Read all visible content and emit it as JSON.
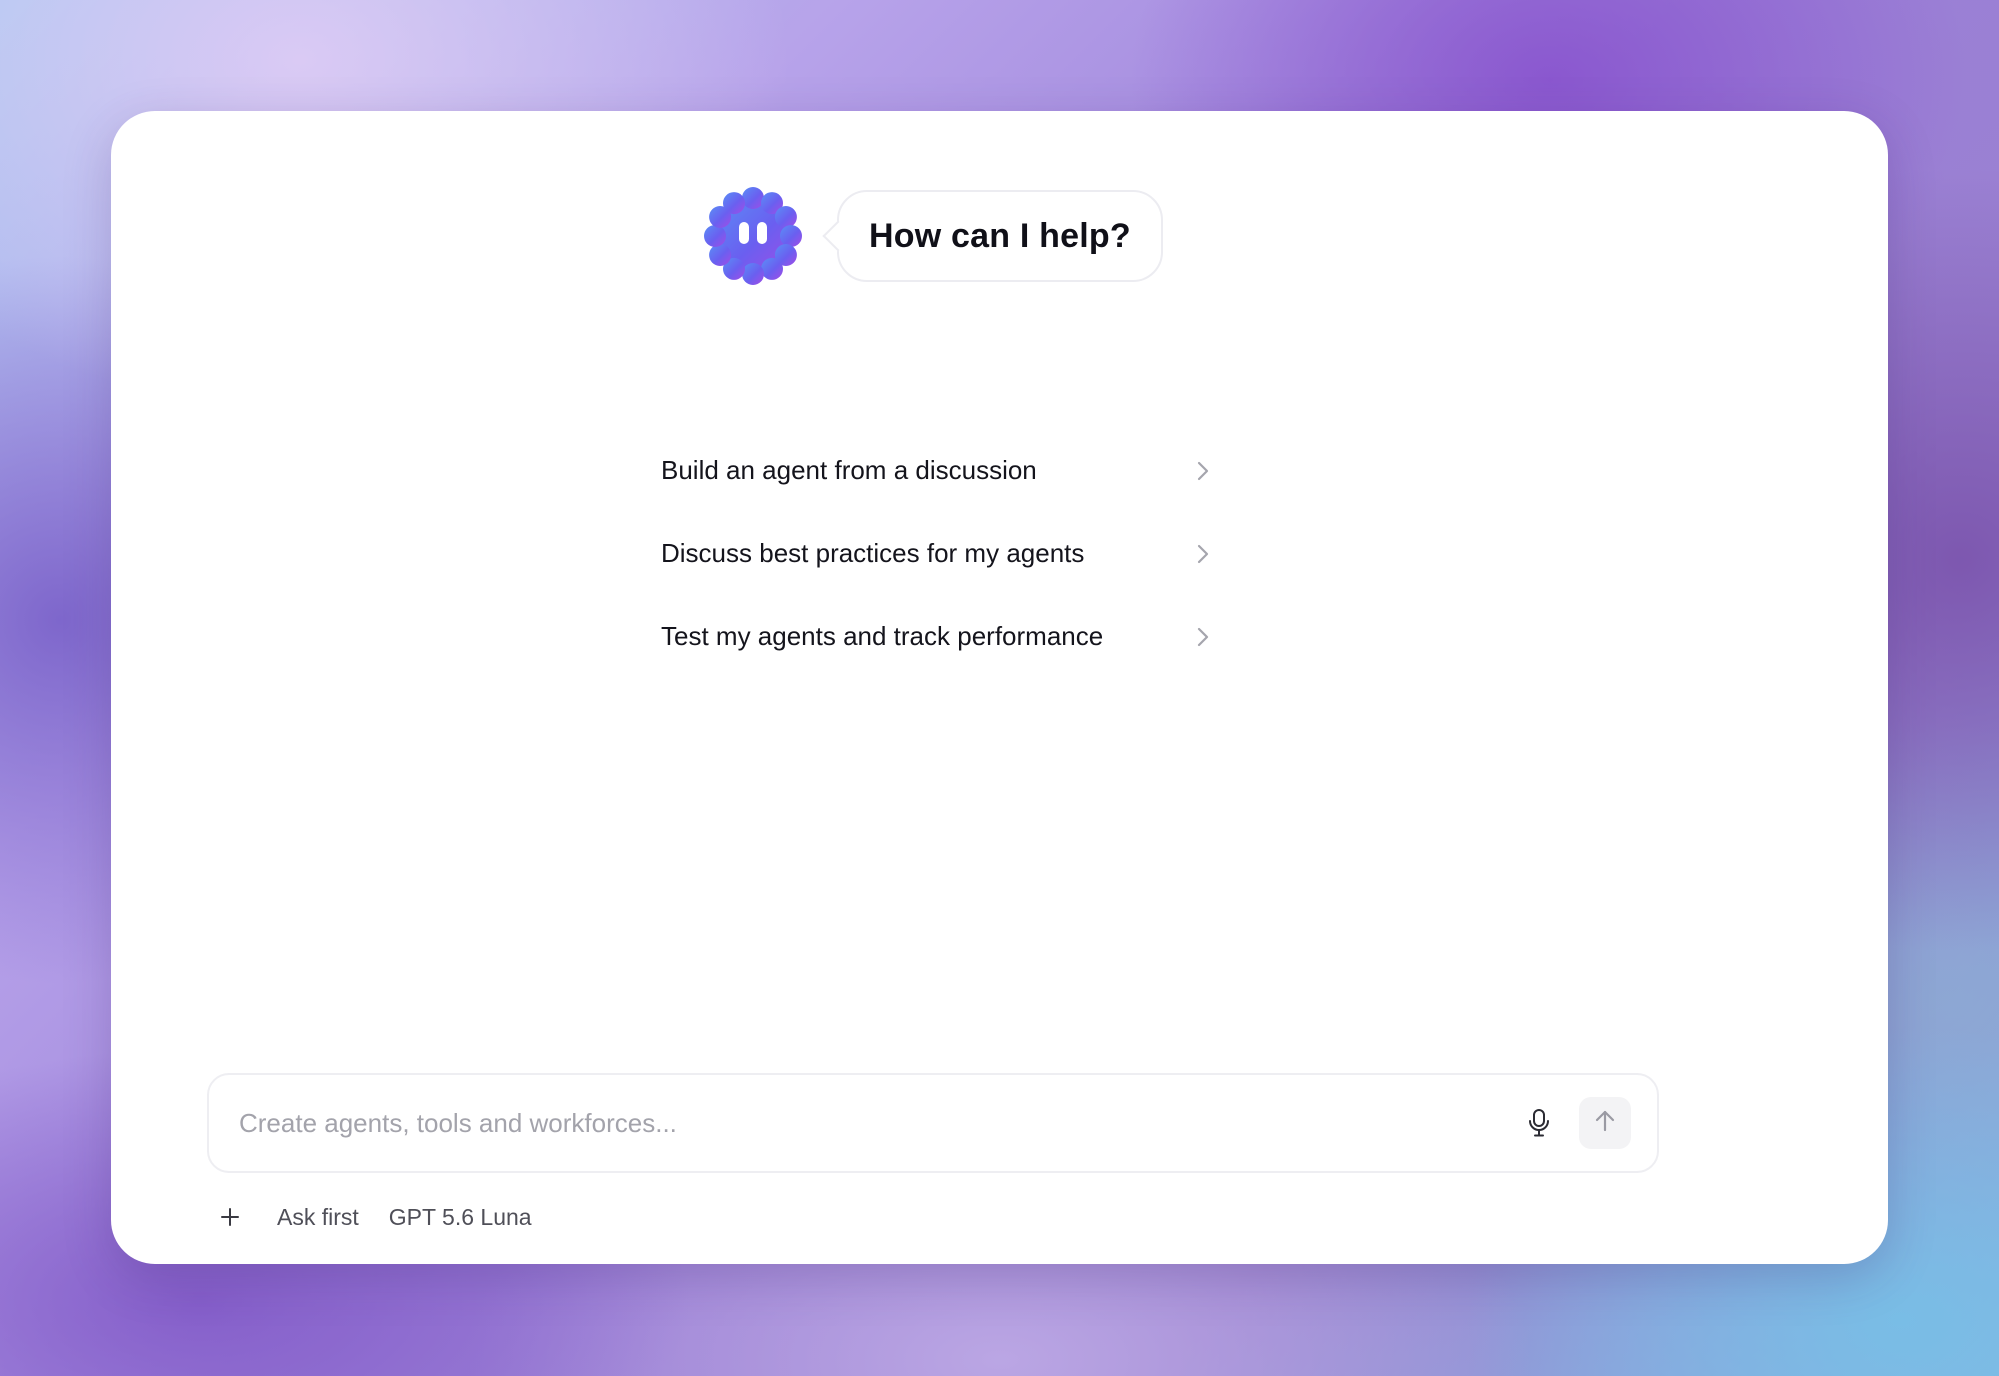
{
  "greeting": {
    "mascot_icon": "wavy-badge-face-icon",
    "message": "How can I help?"
  },
  "suggestions": [
    {
      "label": "Build an agent from a discussion",
      "icon": "chevron-right-icon"
    },
    {
      "label": "Discuss best practices for my agents",
      "icon": "chevron-right-icon"
    },
    {
      "label": "Test my agents and track performance",
      "icon": "chevron-right-icon"
    }
  ],
  "composer": {
    "placeholder": "Create agents, tools and workforces...",
    "value": "",
    "mic_icon": "microphone-icon",
    "send_icon": "arrow-up-icon"
  },
  "footer": {
    "plus_icon": "plus-icon",
    "mode_label": "Ask first",
    "model_label": "GPT 5.6 Luna"
  },
  "colors": {
    "mascot_gradient_start": "#5b8cf5",
    "mascot_gradient_end": "#9a4fe6",
    "text_primary": "#14141c",
    "text_secondary": "#4f4f58",
    "placeholder": "#a3a3ab"
  }
}
